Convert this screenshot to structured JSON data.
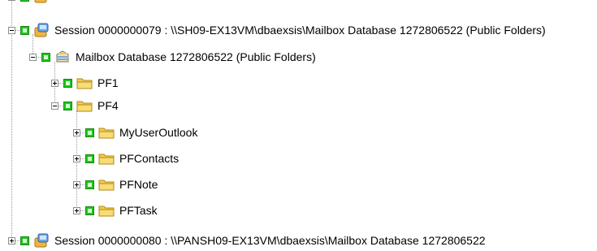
{
  "tree": {
    "session_79": {
      "label": "Session 0000000079 : \\\\SH09-EX13VM\\dbaexsis\\Mailbox Database 1272806522 (Public Folders)",
      "icon": "session-icon",
      "expanded": true,
      "checked": true
    },
    "mailbox_db": {
      "label": "Mailbox Database 1272806522 (Public Folders)",
      "icon": "database-icon",
      "expanded": true,
      "checked": true
    },
    "pf1": {
      "label": "PF1",
      "icon": "folder-icon",
      "expanded": false,
      "checked": true
    },
    "pf4": {
      "label": "PF4",
      "icon": "folder-icon",
      "expanded": true,
      "checked": true
    },
    "pf4_children": [
      {
        "label": "MyUserOutlook",
        "icon": "folder-icon",
        "expanded": false,
        "checked": true
      },
      {
        "label": "PFContacts",
        "icon": "folder-icon",
        "expanded": false,
        "checked": true
      },
      {
        "label": "PFNote",
        "icon": "folder-icon",
        "expanded": false,
        "checked": true
      },
      {
        "label": "PFTask",
        "icon": "folder-icon",
        "expanded": false,
        "checked": true
      }
    ],
    "session_80": {
      "label": "Session 0000000080 : \\\\PANSH09-EX13VM\\dbaexsis\\Mailbox Database 1272806522",
      "icon": "session-icon",
      "expanded": false,
      "checked": true
    }
  },
  "colors": {
    "checkbox_green": "#22c41f",
    "folder_yellow": "#f4cc4c",
    "connector_gray": "#9a9a9a"
  }
}
